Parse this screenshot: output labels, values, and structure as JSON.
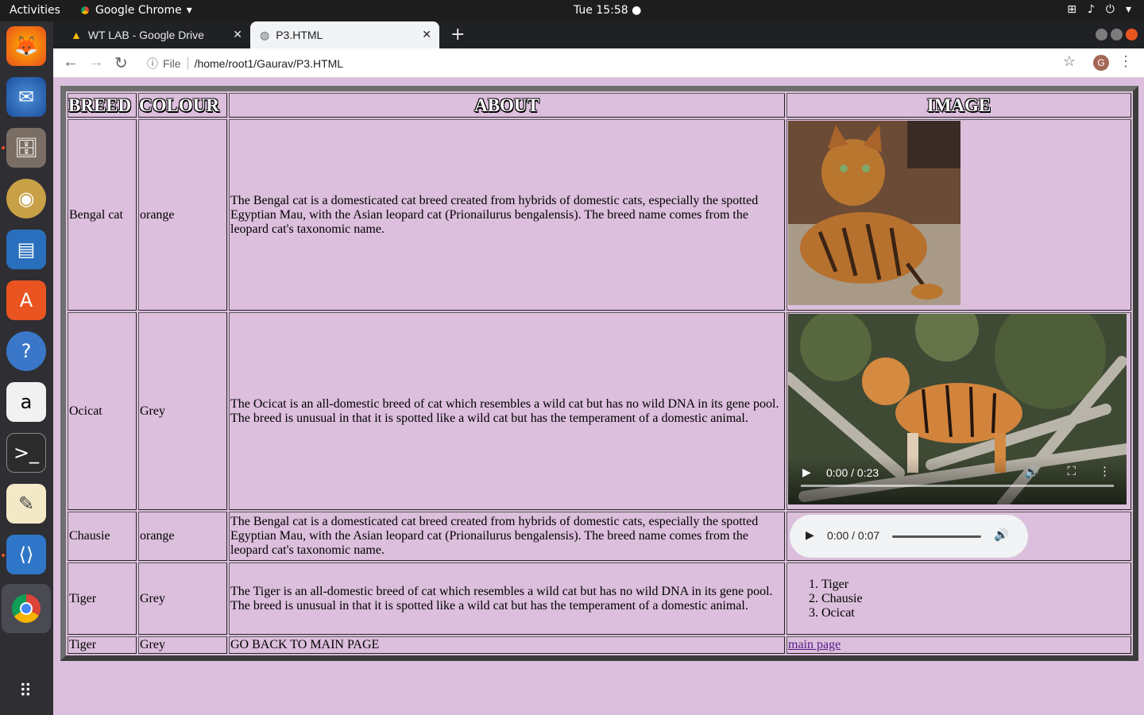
{
  "topbar": {
    "activities": "Activities",
    "app_name": "Google Chrome",
    "clock": "Tue 15:58"
  },
  "tabs": [
    {
      "label": "WT LAB - Google Drive"
    },
    {
      "label": "P3.HTML"
    }
  ],
  "omnibox": {
    "scheme_label": "File",
    "url": "/home/root1/Gaurav/P3.HTML"
  },
  "profile_initial": "G",
  "table": {
    "headers": [
      "BREED",
      "COLOUR",
      "ABOUT",
      "IMAGE"
    ],
    "rows": [
      {
        "breed": "Bengal cat",
        "colour": "orange",
        "about": "The Bengal cat is a domesticated cat breed created from hybrids of domestic cats, especially the spotted Egyptian Mau, with the Asian leopard cat (Prionailurus bengalensis). The breed name comes from the leopard cat's taxonomic name."
      },
      {
        "breed": "Ocicat",
        "colour": "Grey",
        "about": "The Ocicat is an all-domestic breed of cat which resembles a wild cat but has no wild DNA in its gene pool. The breed is unusual in that it is spotted like a wild cat but has the temperament of a domestic animal.",
        "video_time": "0:00 / 0:23"
      },
      {
        "breed": "Chausie",
        "colour": "orange",
        "about": "The Bengal cat is a domesticated cat breed created from hybrids of domestic cats, especially the spotted Egyptian Mau, with the Asian leopard cat (Prionailurus bengalensis). The breed name comes from the leopard cat's taxonomic name.",
        "audio_time": "0:00 / 0:07"
      },
      {
        "breed": "Tiger",
        "colour": "Grey",
        "about": "The Tiger is an all-domestic breed of cat which resembles a wild cat but has no wild DNA in its gene pool. The breed is unusual in that it is spotted like a wild cat but has the temperament of a domestic animal.",
        "list": [
          "Tiger",
          "Chausie",
          "Ocicat"
        ]
      },
      {
        "breed": "Tiger",
        "colour": "Grey",
        "about": "GO BACK TO MAIN PAGE",
        "link": "main page"
      }
    ]
  },
  "colors": {
    "page_bg": "#dcbfdc",
    "table_border": "#3c3c3c",
    "topbar_bg": "#1d1d1d",
    "dock_bg": "#2e2e33",
    "link": "#551a8b"
  }
}
